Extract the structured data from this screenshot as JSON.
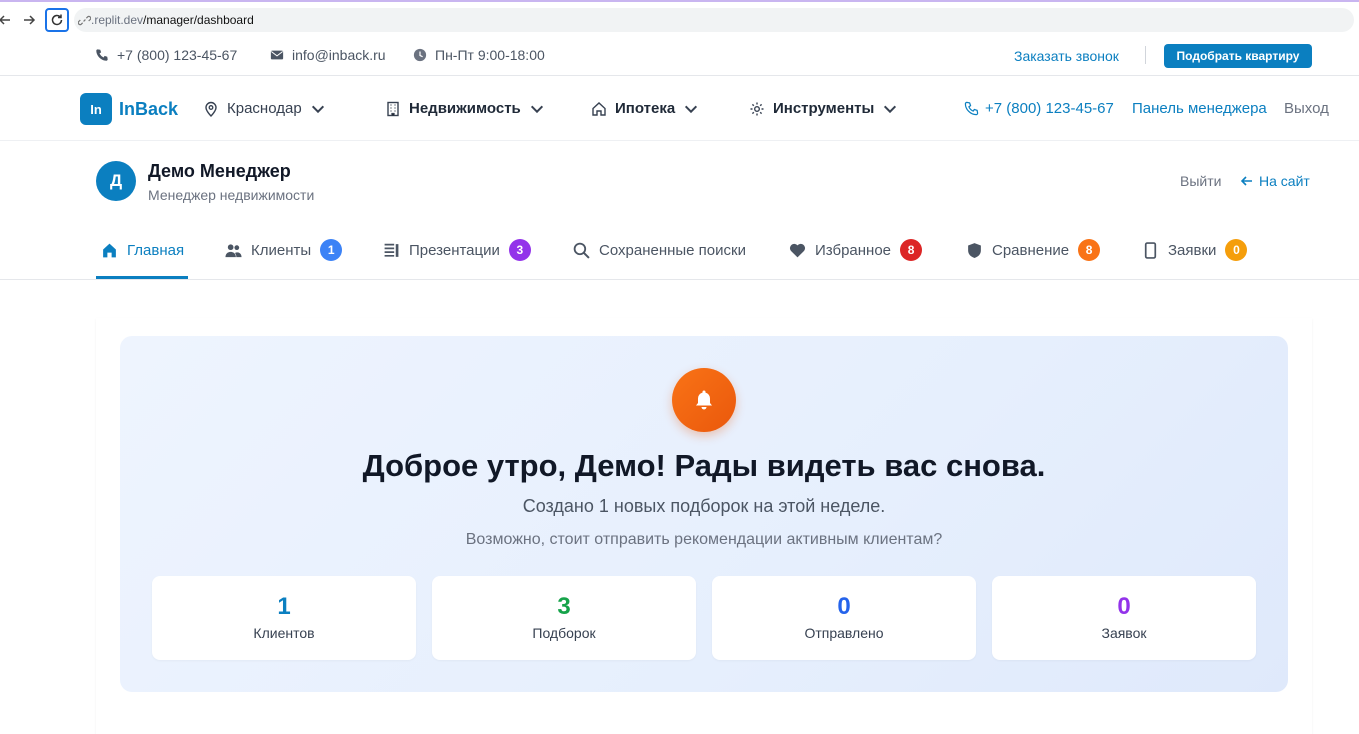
{
  "browser": {
    "url_prefix": ".replit.dev",
    "url_path": "/manager/dashboard"
  },
  "topbar": {
    "phone": "+7 (800) 123-45-67",
    "email": "info@inback.ru",
    "hours": "Пн-Пт 9:00-18:00",
    "callback": "Заказать звонок",
    "pick_button": "Подобрать квартиру"
  },
  "header": {
    "logo_mark": "In",
    "logo_text": "InBack",
    "city": "Краснодар",
    "nav": [
      {
        "label": "Недвижимость",
        "icon": "building-icon"
      },
      {
        "label": "Ипотека",
        "icon": "home-icon"
      },
      {
        "label": "Инструменты",
        "icon": "gear-icon"
      }
    ],
    "phone": "+7 (800) 123-45-67",
    "manager_panel": "Панель менеджера",
    "exit": "Выход"
  },
  "profile": {
    "initial": "Д",
    "name": "Демо Менеджер",
    "role": "Менеджер недвижимости",
    "logout": "Выйти",
    "to_site": "На сайт"
  },
  "tabs": [
    {
      "label": "Главная",
      "icon": "home-icon",
      "active": true
    },
    {
      "label": "Клиенты",
      "icon": "users-icon",
      "badge": "1",
      "badge_color": "#3b82f6"
    },
    {
      "label": "Презентации",
      "icon": "presentation-icon",
      "badge": "3",
      "badge_color": "#9333ea"
    },
    {
      "label": "Сохраненные поиски",
      "icon": "search-icon"
    },
    {
      "label": "Избранное",
      "icon": "heart-icon",
      "badge": "8",
      "badge_color": "#dc2626"
    },
    {
      "label": "Сравнение",
      "icon": "shield-icon",
      "badge": "8",
      "badge_color": "#f97316"
    },
    {
      "label": "Заявки",
      "icon": "phone-device-icon",
      "badge": "0",
      "badge_color": "#f59e0b"
    }
  ],
  "hero": {
    "title": "Доброе утро, Демо! Рады видеть вас снова.",
    "subtitle": "Создано 1 новых подборок на этой неделе.",
    "hint": "Возможно, стоит отправить рекомендации активным клиентам?",
    "stats": [
      {
        "value": "1",
        "label": "Клиентов",
        "color": "#0b7fc0"
      },
      {
        "value": "3",
        "label": "Подборок",
        "color": "#16a34a"
      },
      {
        "value": "0",
        "label": "Отправлено",
        "color": "#2563eb"
      },
      {
        "value": "0",
        "label": "Заявок",
        "color": "#9333ea"
      }
    ]
  },
  "colors": {
    "brand": "#0b7fc0",
    "accent_orange": "#f97316"
  }
}
